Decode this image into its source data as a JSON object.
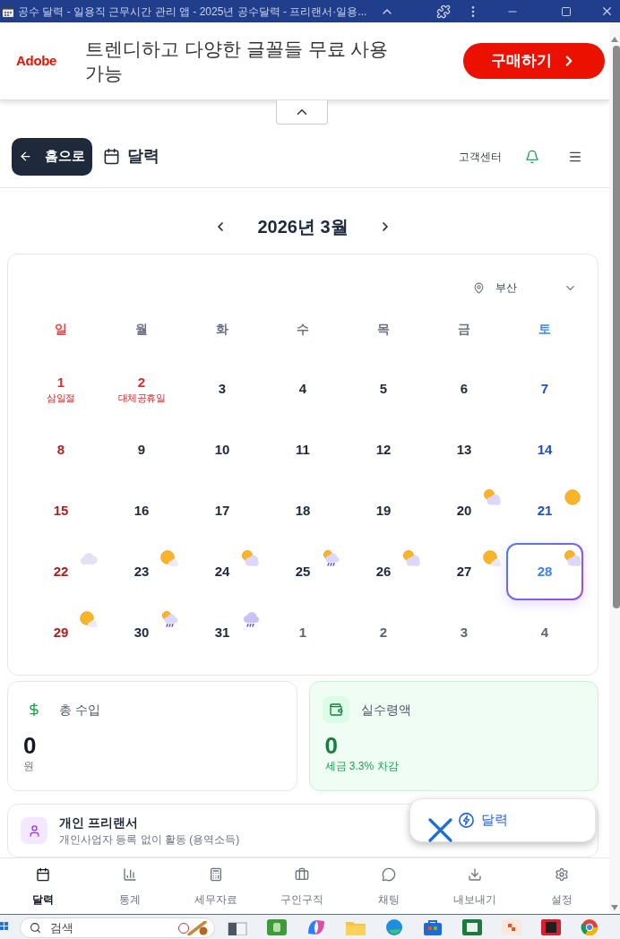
{
  "window": {
    "title": "공수 달력 - 일용직 근무시간 관리 앱 - 2025년 공수달력 - 프리랜서·일용..."
  },
  "ad": {
    "brand": "Adobe",
    "headline": "트렌디하고 다양한 글꼴들 무료 사용 가능",
    "button": "구매하기"
  },
  "header": {
    "back_button": "홈으로",
    "title": "달력",
    "support_link": "고객센터"
  },
  "month_nav": {
    "label": "2026년 3월"
  },
  "calendar": {
    "location": "부산",
    "weekdays": [
      "일",
      "월",
      "화",
      "수",
      "목",
      "금",
      "토"
    ],
    "days": [
      {
        "date": "1",
        "holiday": true,
        "holiday_name": "삼일절",
        "in_month": true,
        "selected": false
      },
      {
        "date": "2",
        "holiday": true,
        "holiday_name": "대체공휴일",
        "in_month": true,
        "selected": false
      },
      {
        "date": "3",
        "holiday": false,
        "in_month": true,
        "selected": false
      },
      {
        "date": "4",
        "holiday": false,
        "in_month": true,
        "selected": false
      },
      {
        "date": "5",
        "holiday": false,
        "in_month": true,
        "selected": false
      },
      {
        "date": "6",
        "holiday": false,
        "in_month": true,
        "selected": false
      },
      {
        "date": "7",
        "holiday": false,
        "in_month": true,
        "selected": false
      },
      {
        "date": "8",
        "holiday": false,
        "in_month": true,
        "selected": false
      },
      {
        "date": "9",
        "holiday": false,
        "in_month": true,
        "selected": false
      },
      {
        "date": "10",
        "holiday": false,
        "in_month": true,
        "selected": false
      },
      {
        "date": "11",
        "holiday": false,
        "in_month": true,
        "selected": false
      },
      {
        "date": "12",
        "holiday": false,
        "in_month": true,
        "selected": false
      },
      {
        "date": "13",
        "holiday": false,
        "in_month": true,
        "selected": false
      },
      {
        "date": "14",
        "holiday": false,
        "in_month": true,
        "selected": false
      },
      {
        "date": "15",
        "holiday": false,
        "in_month": true,
        "selected": false
      },
      {
        "date": "16",
        "holiday": false,
        "in_month": true,
        "selected": false
      },
      {
        "date": "17",
        "holiday": false,
        "in_month": true,
        "selected": false
      },
      {
        "date": "18",
        "holiday": false,
        "in_month": true,
        "selected": false
      },
      {
        "date": "19",
        "holiday": false,
        "in_month": true,
        "selected": false
      },
      {
        "date": "20",
        "holiday": false,
        "in_month": true,
        "selected": false,
        "weather": {
          "kind": "partly_cloudy"
        }
      },
      {
        "date": "21",
        "holiday": false,
        "in_month": true,
        "selected": false,
        "weather": {
          "kind": "sunny"
        }
      },
      {
        "date": "22",
        "holiday": false,
        "in_month": true,
        "selected": false,
        "weather": {
          "kind": "cloudy"
        }
      },
      {
        "date": "23",
        "holiday": false,
        "in_month": true,
        "selected": false,
        "weather": {
          "kind": "mostly_sunny"
        }
      },
      {
        "date": "24",
        "holiday": false,
        "in_month": true,
        "selected": false,
        "weather": {
          "kind": "partly_cloudy"
        }
      },
      {
        "date": "25",
        "holiday": false,
        "in_month": true,
        "selected": false,
        "weather": {
          "kind": "sun_rain"
        }
      },
      {
        "date": "26",
        "holiday": false,
        "in_month": true,
        "selected": false,
        "weather": {
          "kind": "partly_cloudy"
        }
      },
      {
        "date": "27",
        "holiday": false,
        "in_month": true,
        "selected": false,
        "weather": {
          "kind": "mostly_sunny"
        }
      },
      {
        "date": "28",
        "holiday": false,
        "in_month": true,
        "selected": true,
        "weather": {
          "kind": "partly_cloudy"
        }
      },
      {
        "date": "29",
        "holiday": false,
        "in_month": true,
        "selected": false,
        "weather": {
          "kind": "mostly_sunny"
        }
      },
      {
        "date": "30",
        "holiday": false,
        "in_month": true,
        "selected": false,
        "weather": {
          "kind": "sun_rain"
        }
      },
      {
        "date": "31",
        "holiday": false,
        "in_month": true,
        "selected": false,
        "weather": {
          "kind": "rain"
        }
      },
      {
        "date": "1",
        "holiday": false,
        "in_month": false,
        "selected": false
      },
      {
        "date": "2",
        "holiday": false,
        "in_month": false,
        "selected": false
      },
      {
        "date": "3",
        "holiday": false,
        "in_month": false,
        "selected": false
      },
      {
        "date": "4",
        "holiday": false,
        "in_month": false,
        "selected": false
      }
    ]
  },
  "summary": [
    {
      "kind": "gross",
      "label": "총 수입",
      "value": "0",
      "note": "원"
    },
    {
      "kind": "net",
      "label": "실수령액",
      "value": "0",
      "note": "세금 3.3% 차감"
    }
  ],
  "worker_type": {
    "title": "개인 프리랜서",
    "description": "개인사업자 등록 없이 활동 (용역소득)"
  },
  "floating_button": {
    "label": "달력"
  },
  "bottom_nav": [
    {
      "label": "달력",
      "selected": true
    },
    {
      "label": "통계",
      "selected": false
    },
    {
      "label": "세무자료",
      "selected": false
    },
    {
      "label": "구인구직",
      "selected": false
    },
    {
      "label": "채팅",
      "selected": false
    },
    {
      "label": "내보내기",
      "selected": false
    },
    {
      "label": "설정",
      "selected": false
    }
  ],
  "taskbar": {
    "search_placeholder": "검색"
  }
}
